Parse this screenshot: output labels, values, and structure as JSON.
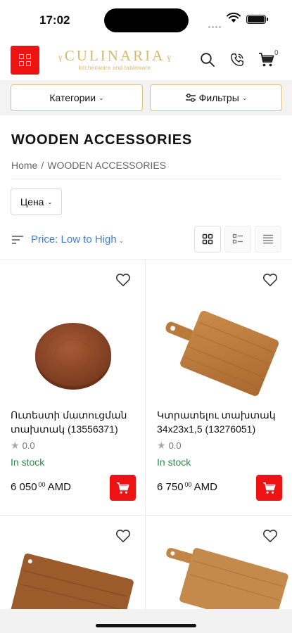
{
  "status": {
    "time": "17:02"
  },
  "header": {
    "brand": "CULINARIA",
    "tagline": "kitchenware and tableware",
    "cart_count": "0"
  },
  "filters": {
    "categories_label": "Категории",
    "filters_label": "Фильтры"
  },
  "page": {
    "title": "WOODEN ACCESSORIES",
    "breadcrumb": {
      "home": "Home",
      "separator": "/",
      "current": "WOODEN ACCESSORIES"
    }
  },
  "price_filter": {
    "label": "Цена"
  },
  "sort": {
    "label": "Price: Low to High"
  },
  "products": [
    {
      "name": "Ուտեստի մատուցման տախտակ (13556371)",
      "rating": "0.0",
      "stock": "In stock",
      "price_main": "6 050",
      "price_minor": "00",
      "currency": "AMD"
    },
    {
      "name": "Կտրատելու տախտակ 34x23x1,5 (13276051)",
      "rating": "0.0",
      "stock": "In stock",
      "price_main": "6 750",
      "price_minor": "00",
      "currency": "AMD"
    },
    {
      "name": "",
      "rating": "",
      "stock": "",
      "price_main": "",
      "price_minor": "",
      "currency": ""
    },
    {
      "name": "",
      "rating": "",
      "stock": "",
      "price_main": "",
      "price_minor": "",
      "currency": ""
    }
  ],
  "colors": {
    "accent_red": "#ee1313",
    "gold": "#d8b86e",
    "link_blue": "#3c7fd0",
    "stock_green": "#2b8a45"
  },
  "icons": [
    "menu-grid-icon",
    "search-icon",
    "phone-icon",
    "cart-icon",
    "sliders-icon",
    "sort-lines-icon",
    "grid-view-icon",
    "list-grid-view-icon",
    "list-view-icon",
    "heart-icon",
    "star-icon",
    "add-to-cart-icon"
  ]
}
